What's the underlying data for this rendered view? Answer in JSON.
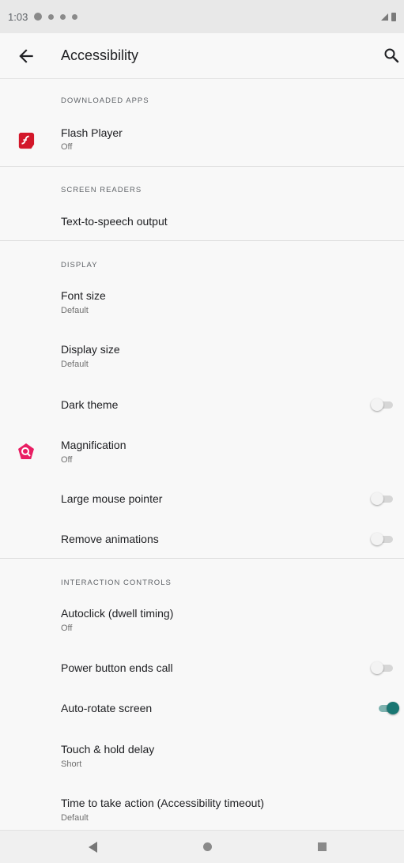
{
  "status_bar": {
    "time": "1:03"
  },
  "app_bar": {
    "title": "Accessibility"
  },
  "sections": {
    "downloaded_apps": "DOWNLOADED APPS",
    "screen_readers": "SCREEN READERS",
    "display": "DISPLAY",
    "interaction_controls": "INTERACTION CONTROLS"
  },
  "items": {
    "flash_player": {
      "title": "Flash Player",
      "subtitle": "Off"
    },
    "tts": {
      "title": "Text-to-speech output"
    },
    "font_size": {
      "title": "Font size",
      "subtitle": "Default"
    },
    "display_size": {
      "title": "Display size",
      "subtitle": "Default"
    },
    "dark_theme": {
      "title": "Dark theme",
      "enabled": false
    },
    "magnification": {
      "title": "Magnification",
      "subtitle": "Off"
    },
    "large_pointer": {
      "title": "Large mouse pointer",
      "enabled": false
    },
    "remove_animations": {
      "title": "Remove animations",
      "enabled": false
    },
    "autoclick": {
      "title": "Autoclick (dwell timing)",
      "subtitle": "Off"
    },
    "power_button": {
      "title": "Power button ends call",
      "enabled": false
    },
    "auto_rotate": {
      "title": "Auto-rotate screen",
      "enabled": true
    },
    "touch_hold": {
      "title": "Touch & hold delay",
      "subtitle": "Short"
    },
    "time_action": {
      "title": "Time to take action (Accessibility timeout)",
      "subtitle": "Default"
    }
  },
  "icons": {
    "back": "arrow-back-icon",
    "search": "search-icon",
    "flash": "flash-player-icon",
    "magnification": "magnification-icon"
  },
  "colors": {
    "accent": "#1a7773",
    "flash_red": "#d3172a",
    "magnify_pink": "#e91e63"
  }
}
